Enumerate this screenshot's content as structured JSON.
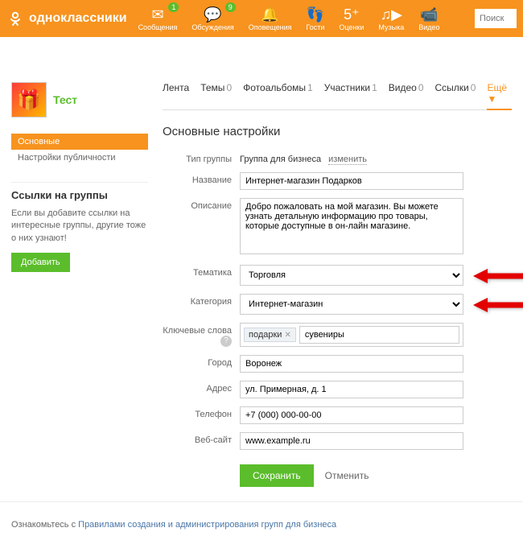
{
  "topbar": {
    "logo": "одноклассники",
    "nav": [
      {
        "label": "Сообщения",
        "badge": "1"
      },
      {
        "label": "Обсуждения",
        "badge": "9"
      },
      {
        "label": "Оповещения"
      },
      {
        "label": "Гости"
      },
      {
        "label": "Оценки"
      },
      {
        "label": "Музыка"
      },
      {
        "label": "Видео"
      }
    ],
    "search_placeholder": "Поиск"
  },
  "group": {
    "title": "Тест"
  },
  "main_tabs": [
    {
      "label": "Лента"
    },
    {
      "label": "Темы",
      "count": "0"
    },
    {
      "label": "Фотоальбомы",
      "count": "1"
    },
    {
      "label": "Участники",
      "count": "1"
    },
    {
      "label": "Видео",
      "count": "0"
    },
    {
      "label": "Ссылки",
      "count": "0"
    },
    {
      "label": "Ещё ▼",
      "active": true
    }
  ],
  "side_tabs": {
    "main": "Основные",
    "publicity": "Настройки публичности"
  },
  "side_block": {
    "title": "Ссылки на группы",
    "text": "Если вы добавите ссылки на интересные группы, другие тоже о них узнают!",
    "button": "Добавить"
  },
  "heading": "Основные настройки",
  "form": {
    "type_label": "Тип группы",
    "type_value": "Группа для бизнеса",
    "type_change": "изменить",
    "name_label": "Название",
    "name_value": "Интернет-магазин Подарков",
    "desc_label": "Описание",
    "desc_value": "Добро пожаловать на мой магазин. Вы можете узнать детальную информацию про товары, которые доступные в он-лайн магазине.",
    "theme_label": "Тематика",
    "theme_value": "Торговля",
    "cat_label": "Категория",
    "cat_value": "Интернет-магазин",
    "keywords_label": "Ключевые слова",
    "keywords_tag": "подарки",
    "keywords_input": "сувениры",
    "city_label": "Город",
    "city_value": "Воронеж",
    "addr_label": "Адрес",
    "addr_value": "ул. Примерная, д. 1",
    "phone_label": "Телефон",
    "phone_value": "+7 (000) 000-00-00",
    "site_label": "Веб-сайт",
    "site_value": "www.example.ru",
    "save": "Сохранить",
    "cancel": "Отменить"
  },
  "footer": {
    "prefix": "Ознакомьтесь с ",
    "link": "Правилами создания и администрирования групп для бизнеса"
  }
}
